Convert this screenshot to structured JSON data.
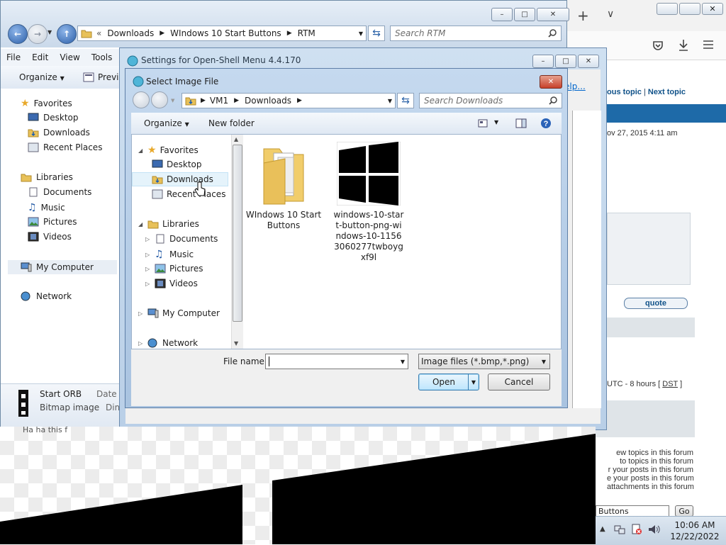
{
  "browser": {
    "forum": {
      "prev_topic": "ous topic",
      "separator": "|",
      "next_topic": "Next topic",
      "date": "ov 27, 2015 4:11 am",
      "quote_button": "quote",
      "timezone": "UTC - 8 hours [",
      "dst": "DST",
      "timezone_end": "]",
      "permissions": [
        "ew topics in this forum",
        "to topics in this forum",
        "r your posts in this forum",
        "e your posts in this forum",
        "attachments in this forum"
      ],
      "jump_select": "Buttons",
      "go_button": "Go"
    },
    "help_link": "elp..."
  },
  "explorer": {
    "path": [
      "Downloads",
      "WIndows 10 Start Buttons",
      "RTM"
    ],
    "search_placeholder": "Search RTM",
    "menu": [
      "File",
      "Edit",
      "View",
      "Tools"
    ],
    "organize": "Organize",
    "preview": "Previe",
    "nav": {
      "favorites": "Favorites",
      "desktop": "Desktop",
      "downloads": "Downloads",
      "recent": "Recent Places",
      "libraries": "Libraries",
      "documents": "Documents",
      "music": "Music",
      "pictures": "Pictures",
      "videos": "Videos",
      "computer": "My Computer",
      "network": "Network"
    },
    "details": {
      "name": "Start ORB",
      "type": "Bitmap image",
      "date_label": "Date m",
      "dim_label": "Dim"
    },
    "status_partial": "Ha       ha           this f"
  },
  "settings": {
    "title": "Settings for Open-Shell Menu 4.4.170"
  },
  "dialog": {
    "title": "Select Image File",
    "path": [
      "VM1",
      "Downloads"
    ],
    "search_placeholder": "Search Downloads",
    "organize": "Organize",
    "new_folder": "New folder",
    "tree": {
      "favorites": "Favorites",
      "desktop": "Desktop",
      "downloads": "Downloads",
      "recent": "Recent Places",
      "libraries": "Libraries",
      "documents": "Documents",
      "music": "Music",
      "pictures": "Pictures",
      "videos": "Videos",
      "computer": "My Computer",
      "network": "Network"
    },
    "files": [
      {
        "name": "WIndows 10 Start Buttons",
        "kind": "folder-icon"
      },
      {
        "name": "windows-10-start-button-png-windows-10-11563060277twboygxf9l",
        "kind": "windows-logo-icon"
      }
    ],
    "filename_label": "File name:",
    "filename_value": "",
    "filter": "Image files (*.bmp,*.png)",
    "open_button": "Open",
    "cancel_button": "Cancel"
  },
  "taskbar": {
    "time": "10:06 AM",
    "date": "12/22/2022"
  },
  "colors": {
    "accent": "#1e5c9a",
    "title_bar": "#c5d9ef",
    "forum_link": "#105289"
  }
}
